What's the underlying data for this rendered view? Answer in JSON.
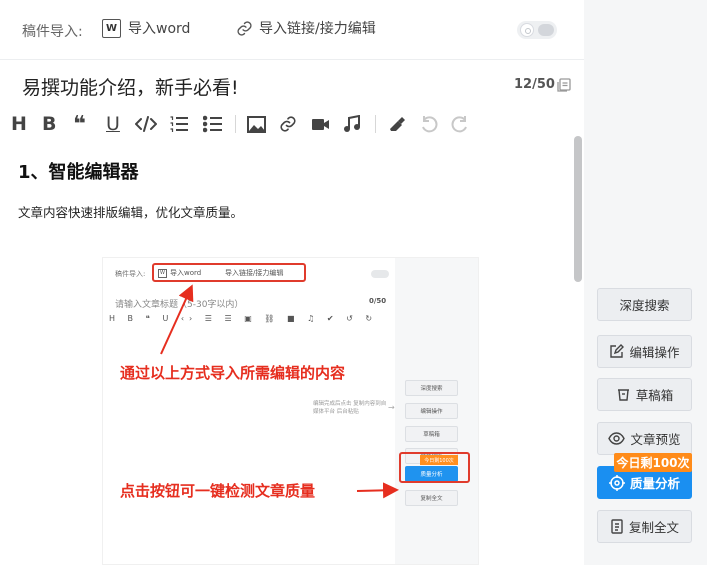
{
  "import_bar": {
    "label": "稿件导入:",
    "word_button": "导入word",
    "word_icon_letter": "W",
    "link_button": "导入链接/接力编辑"
  },
  "article": {
    "title": "易撰功能介绍，新手必看!",
    "title_count": "12/50"
  },
  "content": {
    "heading": "1、智能编辑器",
    "paragraph": "文章内容快速排版编辑，优化文章质量。"
  },
  "embedded_screenshot": {
    "import_label": "稿件导入:",
    "word_button": "导入word",
    "word_icon_letter": "W",
    "link_button": "导入链接/接力编辑",
    "title_placeholder": "请输入文章标题（5-30字以内）",
    "title_count": "0/50",
    "toolbar_glyphs": "H B ❝ U ‹› ☰ ☰ ▣ ⛓ ■ ♫ ✔ ↺ ↻",
    "annotation_import": "通过以上方式导入所需编辑的内容",
    "annotation_quality": "点击按钮可一键检测文章质量",
    "note": "编辑完成后点击 复制内容到自媒体平台 后台粘贴",
    "side_buttons": [
      "深度搜索",
      "编辑操作",
      "草稿箱",
      "文章预览",
      "质量分析",
      "复制全文"
    ],
    "badge": "今日剩100次"
  },
  "side_panel": {
    "deep_search": "深度搜索",
    "edit_ops": "编辑操作",
    "drafts": "草稿箱",
    "preview": "文章预览",
    "quality": "质量分析",
    "copy_all": "复制全文",
    "badge": "今日剩100次"
  },
  "colors": {
    "primary": "#1a8ff1",
    "badge": "#ff8b19",
    "annotation_red": "#e62e1f"
  }
}
